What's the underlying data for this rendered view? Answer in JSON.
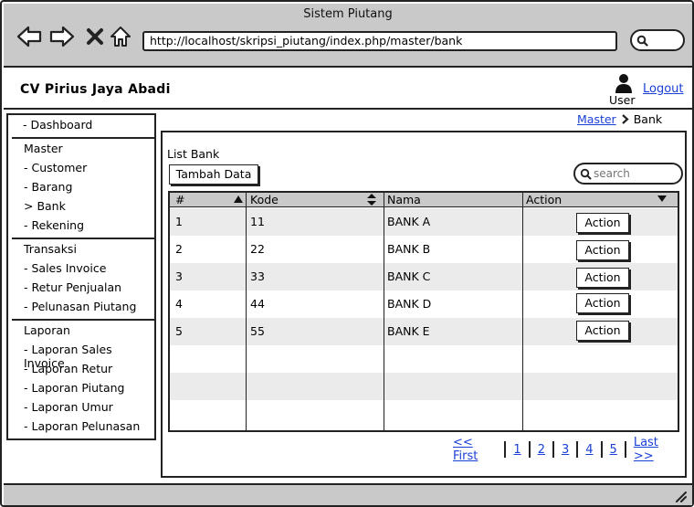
{
  "window": {
    "title": "Sistem Piutang"
  },
  "browser": {
    "url": "http://localhost/skripsi_piutang/index.php/master/bank"
  },
  "header": {
    "company": "CV Pirius Jaya Abadi",
    "user_label": "User",
    "logout_label": "Logout"
  },
  "sidebar": {
    "dashboard": "- Dashboard",
    "master": {
      "heading": "Master",
      "items": [
        "- Customer",
        "- Barang",
        "> Bank",
        "- Rekening"
      ]
    },
    "transaksi": {
      "heading": "Transaksi",
      "items": [
        "- Sales Invoice",
        "- Retur Penjualan",
        "- Pelunasan Piutang"
      ]
    },
    "laporan": {
      "heading": "Laporan",
      "items": [
        "- Laporan Sales Invoice",
        "- Laporan Retur",
        "- Laporan Piutang",
        "- Laporan Umur",
        "- Laporan Pelunasan"
      ]
    }
  },
  "breadcrumb": {
    "parent": "Master",
    "current": "Bank"
  },
  "main": {
    "list_title": "List Bank",
    "add_button": "Tambah Data",
    "search_placeholder": "search"
  },
  "table": {
    "columns": [
      "#",
      "Kode",
      "Nama",
      "Action"
    ],
    "rows": [
      {
        "no": "1",
        "kode": "11",
        "nama": "BANK A",
        "action": "Action"
      },
      {
        "no": "2",
        "kode": "22",
        "nama": "BANK B",
        "action": "Action"
      },
      {
        "no": "3",
        "kode": "33",
        "nama": "BANK C",
        "action": "Action"
      },
      {
        "no": "4",
        "kode": "44",
        "nama": "BANK D",
        "action": "Action"
      },
      {
        "no": "5",
        "kode": "55",
        "nama": "BANK E",
        "action": "Action"
      }
    ]
  },
  "pagination": {
    "first": "<< First",
    "pages": [
      "1",
      "2",
      "3",
      "4",
      "5"
    ],
    "last": "Last >>"
  },
  "colors": {
    "link": "#1a3fd6",
    "chrome": "#c9c9c9",
    "row_alt": "#ebebeb"
  }
}
